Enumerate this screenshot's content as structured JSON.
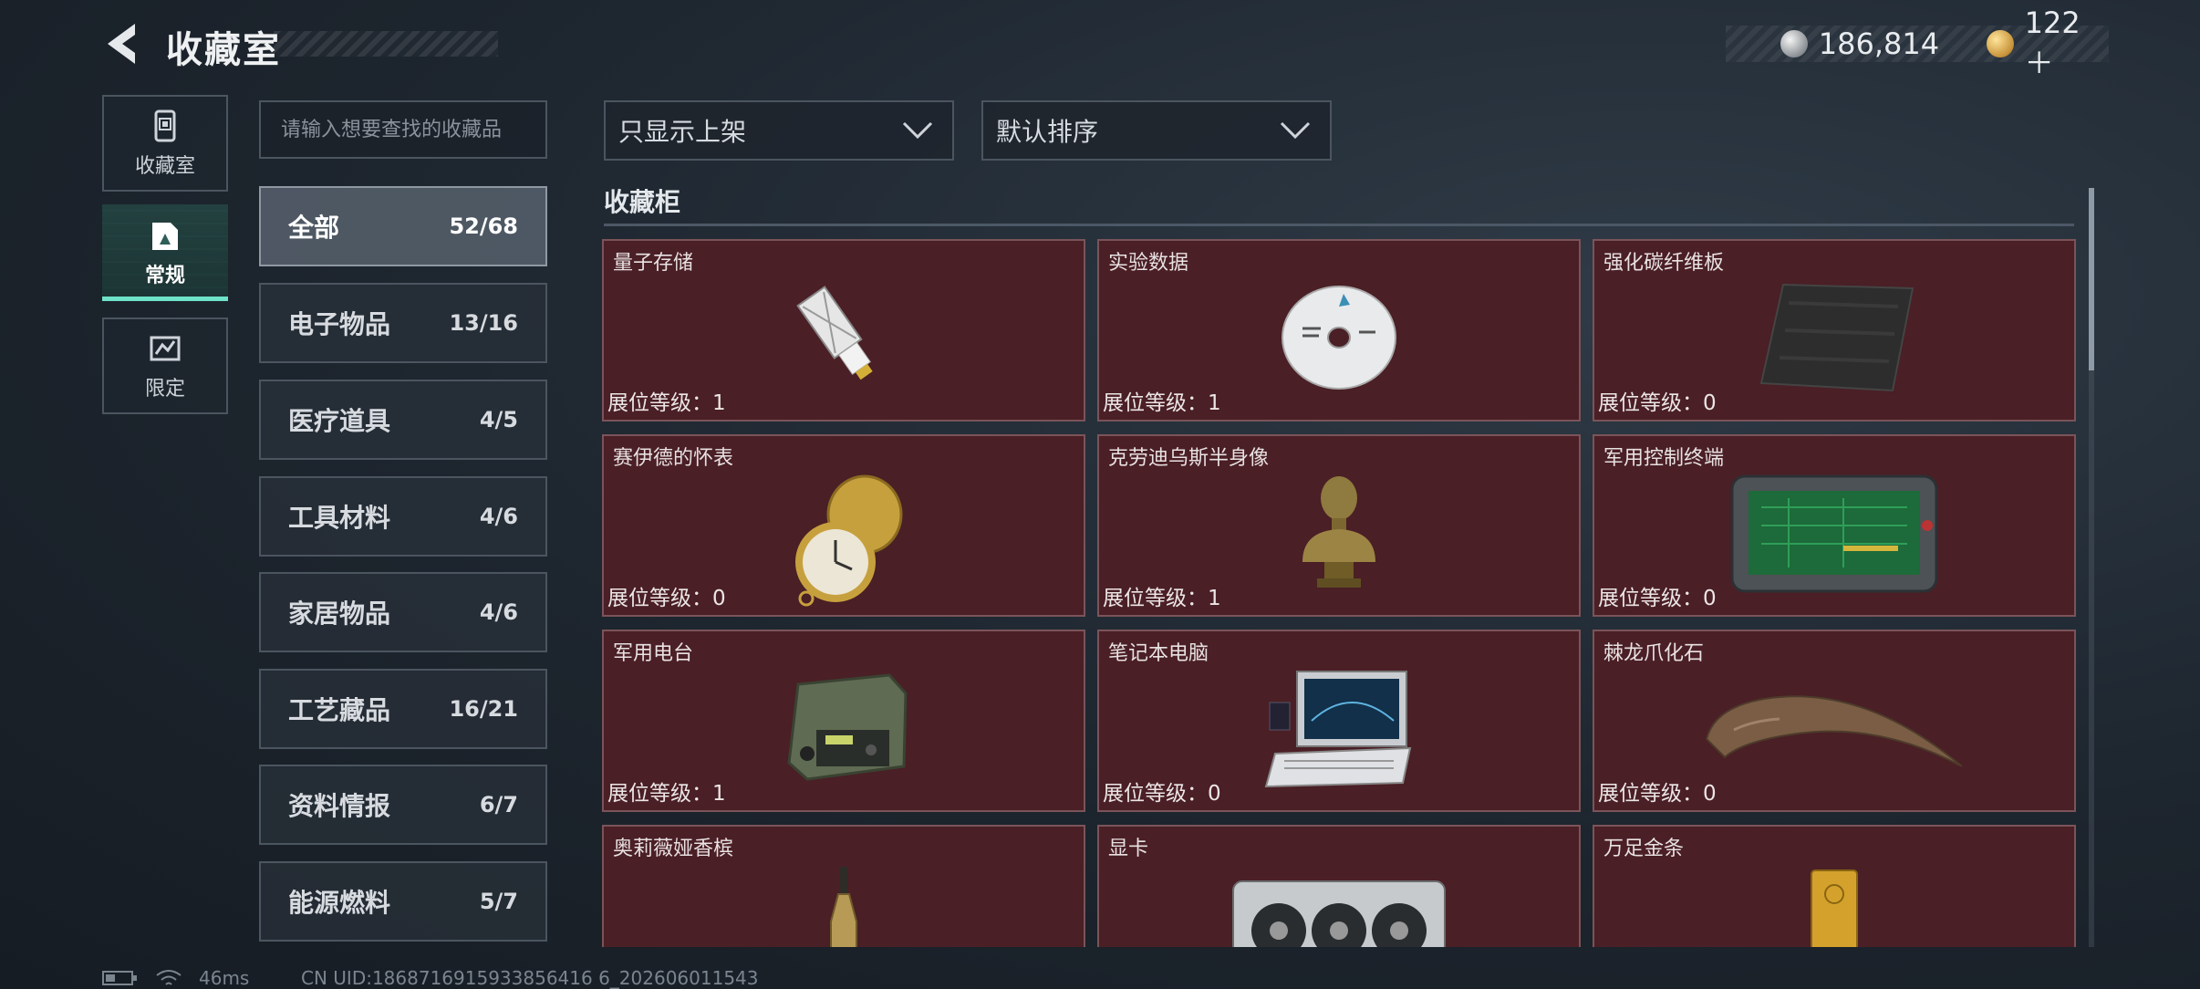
{
  "header": {
    "title": "收藏室",
    "currency": [
      {
        "icon": "silver-coin-icon",
        "value": "186,814"
      },
      {
        "icon": "gold-coin-icon",
        "value": "122＋"
      }
    ]
  },
  "left_tabs": [
    {
      "label": "收藏室",
      "icon": "collection-room-icon"
    },
    {
      "label": "常规",
      "icon": "normal-icon",
      "active": true
    },
    {
      "label": "限定",
      "icon": "limited-icon"
    }
  ],
  "search": {
    "placeholder": "请输入想要查找的收藏品"
  },
  "categories": [
    {
      "name": "全部",
      "count": "52/68",
      "active": true
    },
    {
      "name": "电子物品",
      "count": "13/16"
    },
    {
      "name": "医疗道具",
      "count": "4/5"
    },
    {
      "name": "工具材料",
      "count": "4/6"
    },
    {
      "name": "家居物品",
      "count": "4/6"
    },
    {
      "name": "工艺藏品",
      "count": "16/21"
    },
    {
      "name": "资料情报",
      "count": "6/7"
    },
    {
      "name": "能源燃料",
      "count": "5/7"
    }
  ],
  "filters": {
    "show_listed": "只显示上架",
    "sort": "默认排序"
  },
  "section": {
    "title": "收藏柜"
  },
  "items": [
    {
      "name": "量子存储",
      "level": "展位等级：1",
      "icon": "usb-drive-icon"
    },
    {
      "name": "实验数据",
      "level": "展位等级：1",
      "icon": "disc-icon"
    },
    {
      "name": "强化碳纤维板",
      "level": "展位等级：0",
      "icon": "carbon-plate-icon"
    },
    {
      "name": "赛伊德的怀表",
      "level": "展位等级：0",
      "icon": "pocket-watch-icon"
    },
    {
      "name": "克劳迪乌斯半身像",
      "level": "展位等级：1",
      "icon": "bust-icon"
    },
    {
      "name": "军用控制终端",
      "level": "展位等级：0",
      "icon": "control-terminal-icon"
    },
    {
      "name": "军用电台",
      "level": "展位等级：1",
      "icon": "radio-icon"
    },
    {
      "name": "笔记本电脑",
      "level": "展位等级：0",
      "icon": "laptop-icon"
    },
    {
      "name": "棘龙爪化石",
      "level": "展位等级：0",
      "icon": "claw-fossil-icon"
    },
    {
      "name": "奥莉薇娅香槟",
      "level": "",
      "icon": "champagne-icon"
    },
    {
      "name": "显卡",
      "level": "",
      "icon": "graphics-card-icon"
    },
    {
      "name": "万足金条",
      "level": "",
      "icon": "gold-bar-icon"
    }
  ],
  "status": {
    "ping": "46ms",
    "uid": "CN UID:1868716915933856416 6_202606011543"
  }
}
